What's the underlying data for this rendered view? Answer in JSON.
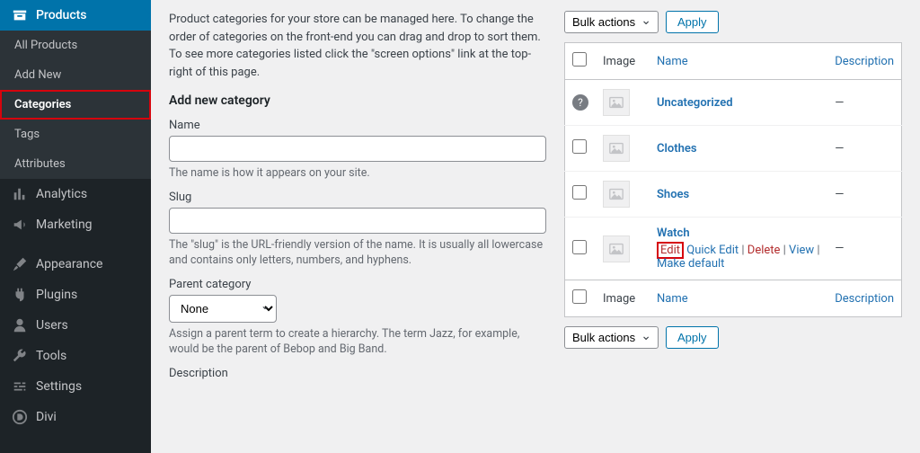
{
  "sidebar": {
    "top_item": "Products",
    "submenu": [
      "All Products",
      "Add New",
      "Categories",
      "Tags",
      "Attributes"
    ],
    "rest": [
      {
        "icon": "analytics",
        "label": "Analytics"
      },
      {
        "icon": "marketing",
        "label": "Marketing"
      },
      {
        "icon": "appearance",
        "label": "Appearance"
      },
      {
        "icon": "plugins",
        "label": "Plugins"
      },
      {
        "icon": "users",
        "label": "Users"
      },
      {
        "icon": "tools",
        "label": "Tools"
      },
      {
        "icon": "settings",
        "label": "Settings"
      },
      {
        "icon": "divi",
        "label": "Divi"
      }
    ]
  },
  "intro": "Product categories for your store can be managed here. To change the order of categories on the front-end you can drag and drop to sort them. To see more categories listed click the \"screen options\" link at the top-right of this page.",
  "form": {
    "heading": "Add new category",
    "name_label": "Name",
    "name_desc": "The name is how it appears on your site.",
    "slug_label": "Slug",
    "slug_desc": "The \"slug\" is the URL-friendly version of the name. It is usually all lowercase and contains only letters, numbers, and hyphens.",
    "parent_label": "Parent category",
    "parent_value": "None",
    "parent_desc": "Assign a parent term to create a hierarchy. The term Jazz, for example, would be the parent of Bebop and Big Band.",
    "desc_label": "Description"
  },
  "bulk": {
    "label": "Bulk actions",
    "apply": "Apply"
  },
  "table": {
    "headers": {
      "image": "Image",
      "name": "Name",
      "description": "Description"
    },
    "rows": [
      {
        "help": true,
        "name": "Uncategorized",
        "desc": "—",
        "actions": false
      },
      {
        "help": false,
        "name": "Clothes",
        "desc": "—",
        "actions": false
      },
      {
        "help": false,
        "name": "Shoes",
        "desc": "—",
        "actions": false
      },
      {
        "help": false,
        "name": "Watch",
        "desc": "—",
        "actions": true
      }
    ],
    "actions": {
      "edit": "Edit",
      "quick": "Quick Edit",
      "del": "Delete",
      "view": "View",
      "make_default": "Make default"
    }
  }
}
